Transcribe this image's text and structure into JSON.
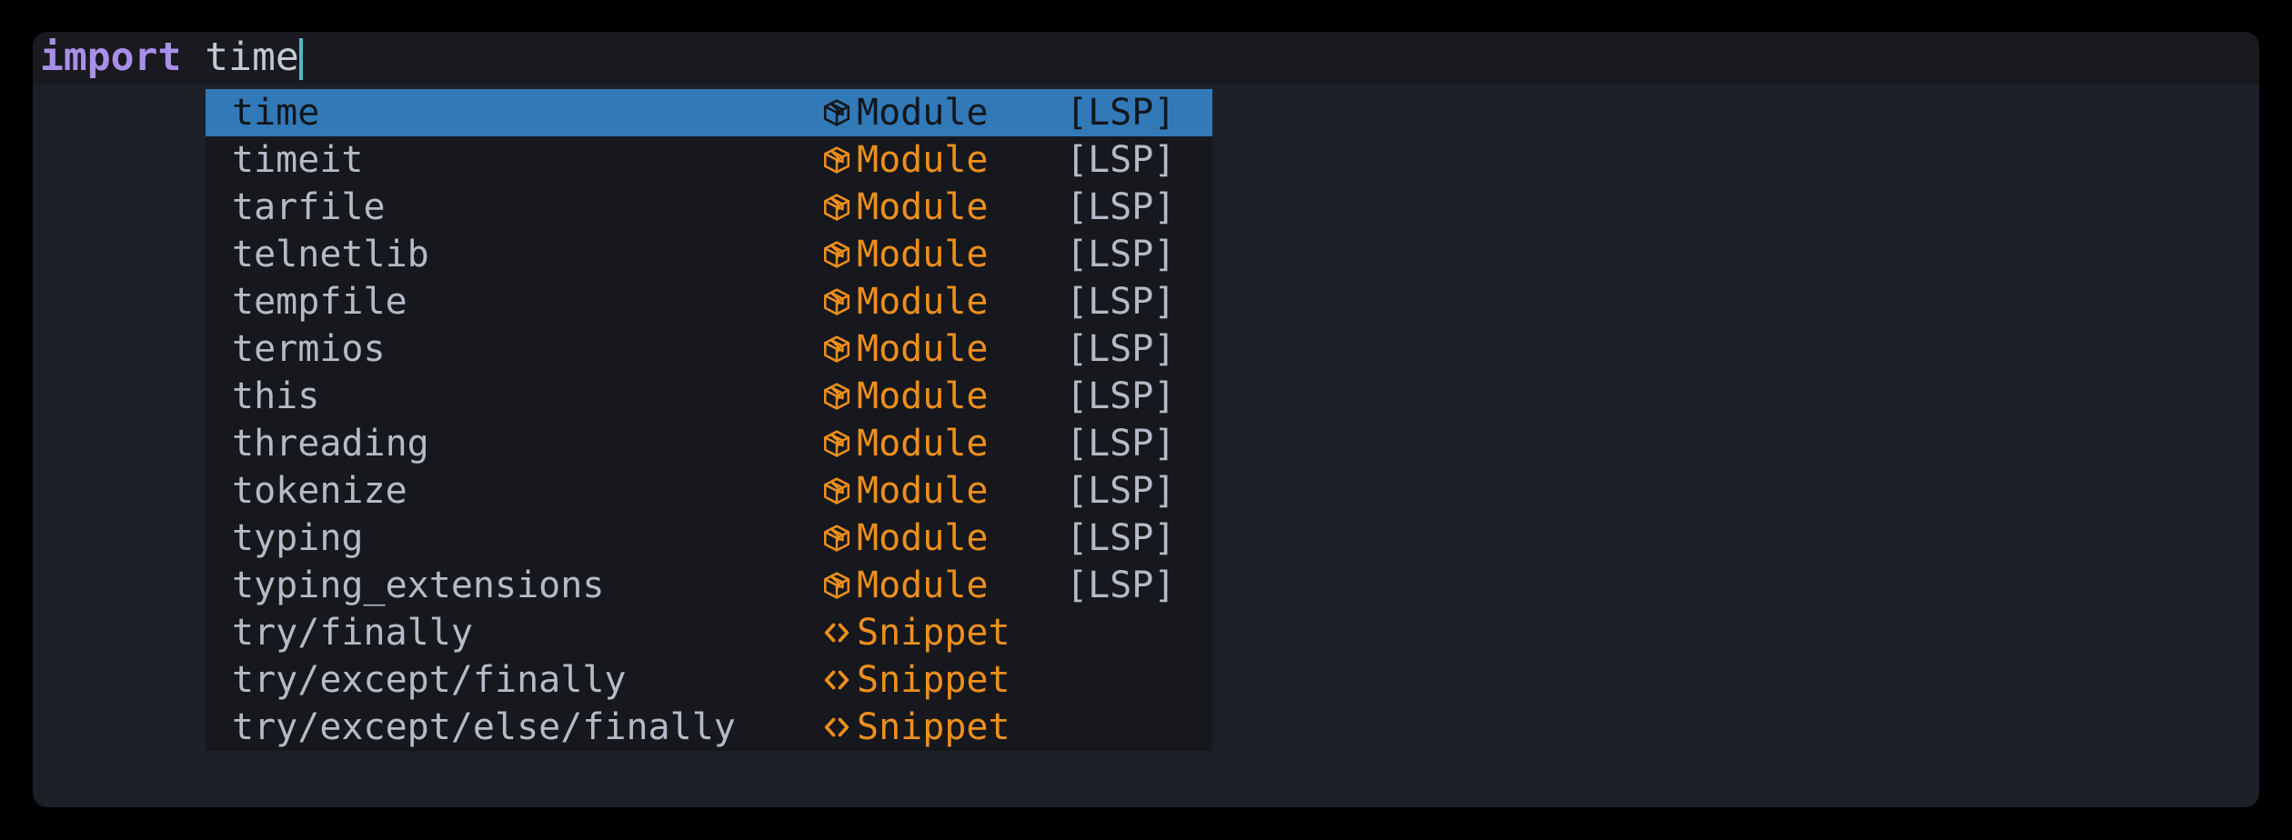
{
  "window": {
    "background": "#1D2027",
    "outer_background": "#000000"
  },
  "editor": {
    "lines": [
      {
        "keyword": "import",
        "space": " ",
        "text": "time",
        "has_cursor": true,
        "cursorline": true
      }
    ],
    "keyword_color": "#A88FE8",
    "text_color": "#C3C9D4",
    "caret_color": "#56B6C2"
  },
  "completion": {
    "selected_index": 0,
    "selected_background": "#3279B8",
    "popup_background": "#16181D",
    "kind_color": "#ED8F1C",
    "label_color": "#B4BBC6",
    "items": [
      {
        "label": "time",
        "kind": "Module",
        "kind_icon": "package-icon",
        "source": "[LSP]"
      },
      {
        "label": "timeit",
        "kind": "Module",
        "kind_icon": "package-icon",
        "source": "[LSP]"
      },
      {
        "label": "tarfile",
        "kind": "Module",
        "kind_icon": "package-icon",
        "source": "[LSP]"
      },
      {
        "label": "telnetlib",
        "kind": "Module",
        "kind_icon": "package-icon",
        "source": "[LSP]"
      },
      {
        "label": "tempfile",
        "kind": "Module",
        "kind_icon": "package-icon",
        "source": "[LSP]"
      },
      {
        "label": "termios",
        "kind": "Module",
        "kind_icon": "package-icon",
        "source": "[LSP]"
      },
      {
        "label": "this",
        "kind": "Module",
        "kind_icon": "package-icon",
        "source": "[LSP]"
      },
      {
        "label": "threading",
        "kind": "Module",
        "kind_icon": "package-icon",
        "source": "[LSP]"
      },
      {
        "label": "tokenize",
        "kind": "Module",
        "kind_icon": "package-icon",
        "source": "[LSP]"
      },
      {
        "label": "typing",
        "kind": "Module",
        "kind_icon": "package-icon",
        "source": "[LSP]"
      },
      {
        "label": "typing_extensions",
        "kind": "Module",
        "kind_icon": "package-icon",
        "source": "[LSP]"
      },
      {
        "label": "try/finally",
        "kind": "Snippet",
        "kind_icon": "angle-brackets-icon",
        "source": ""
      },
      {
        "label": "try/except/finally",
        "kind": "Snippet",
        "kind_icon": "angle-brackets-icon",
        "source": ""
      },
      {
        "label": "try/except/else/finally",
        "kind": "Snippet",
        "kind_icon": "angle-brackets-icon",
        "source": ""
      }
    ]
  }
}
